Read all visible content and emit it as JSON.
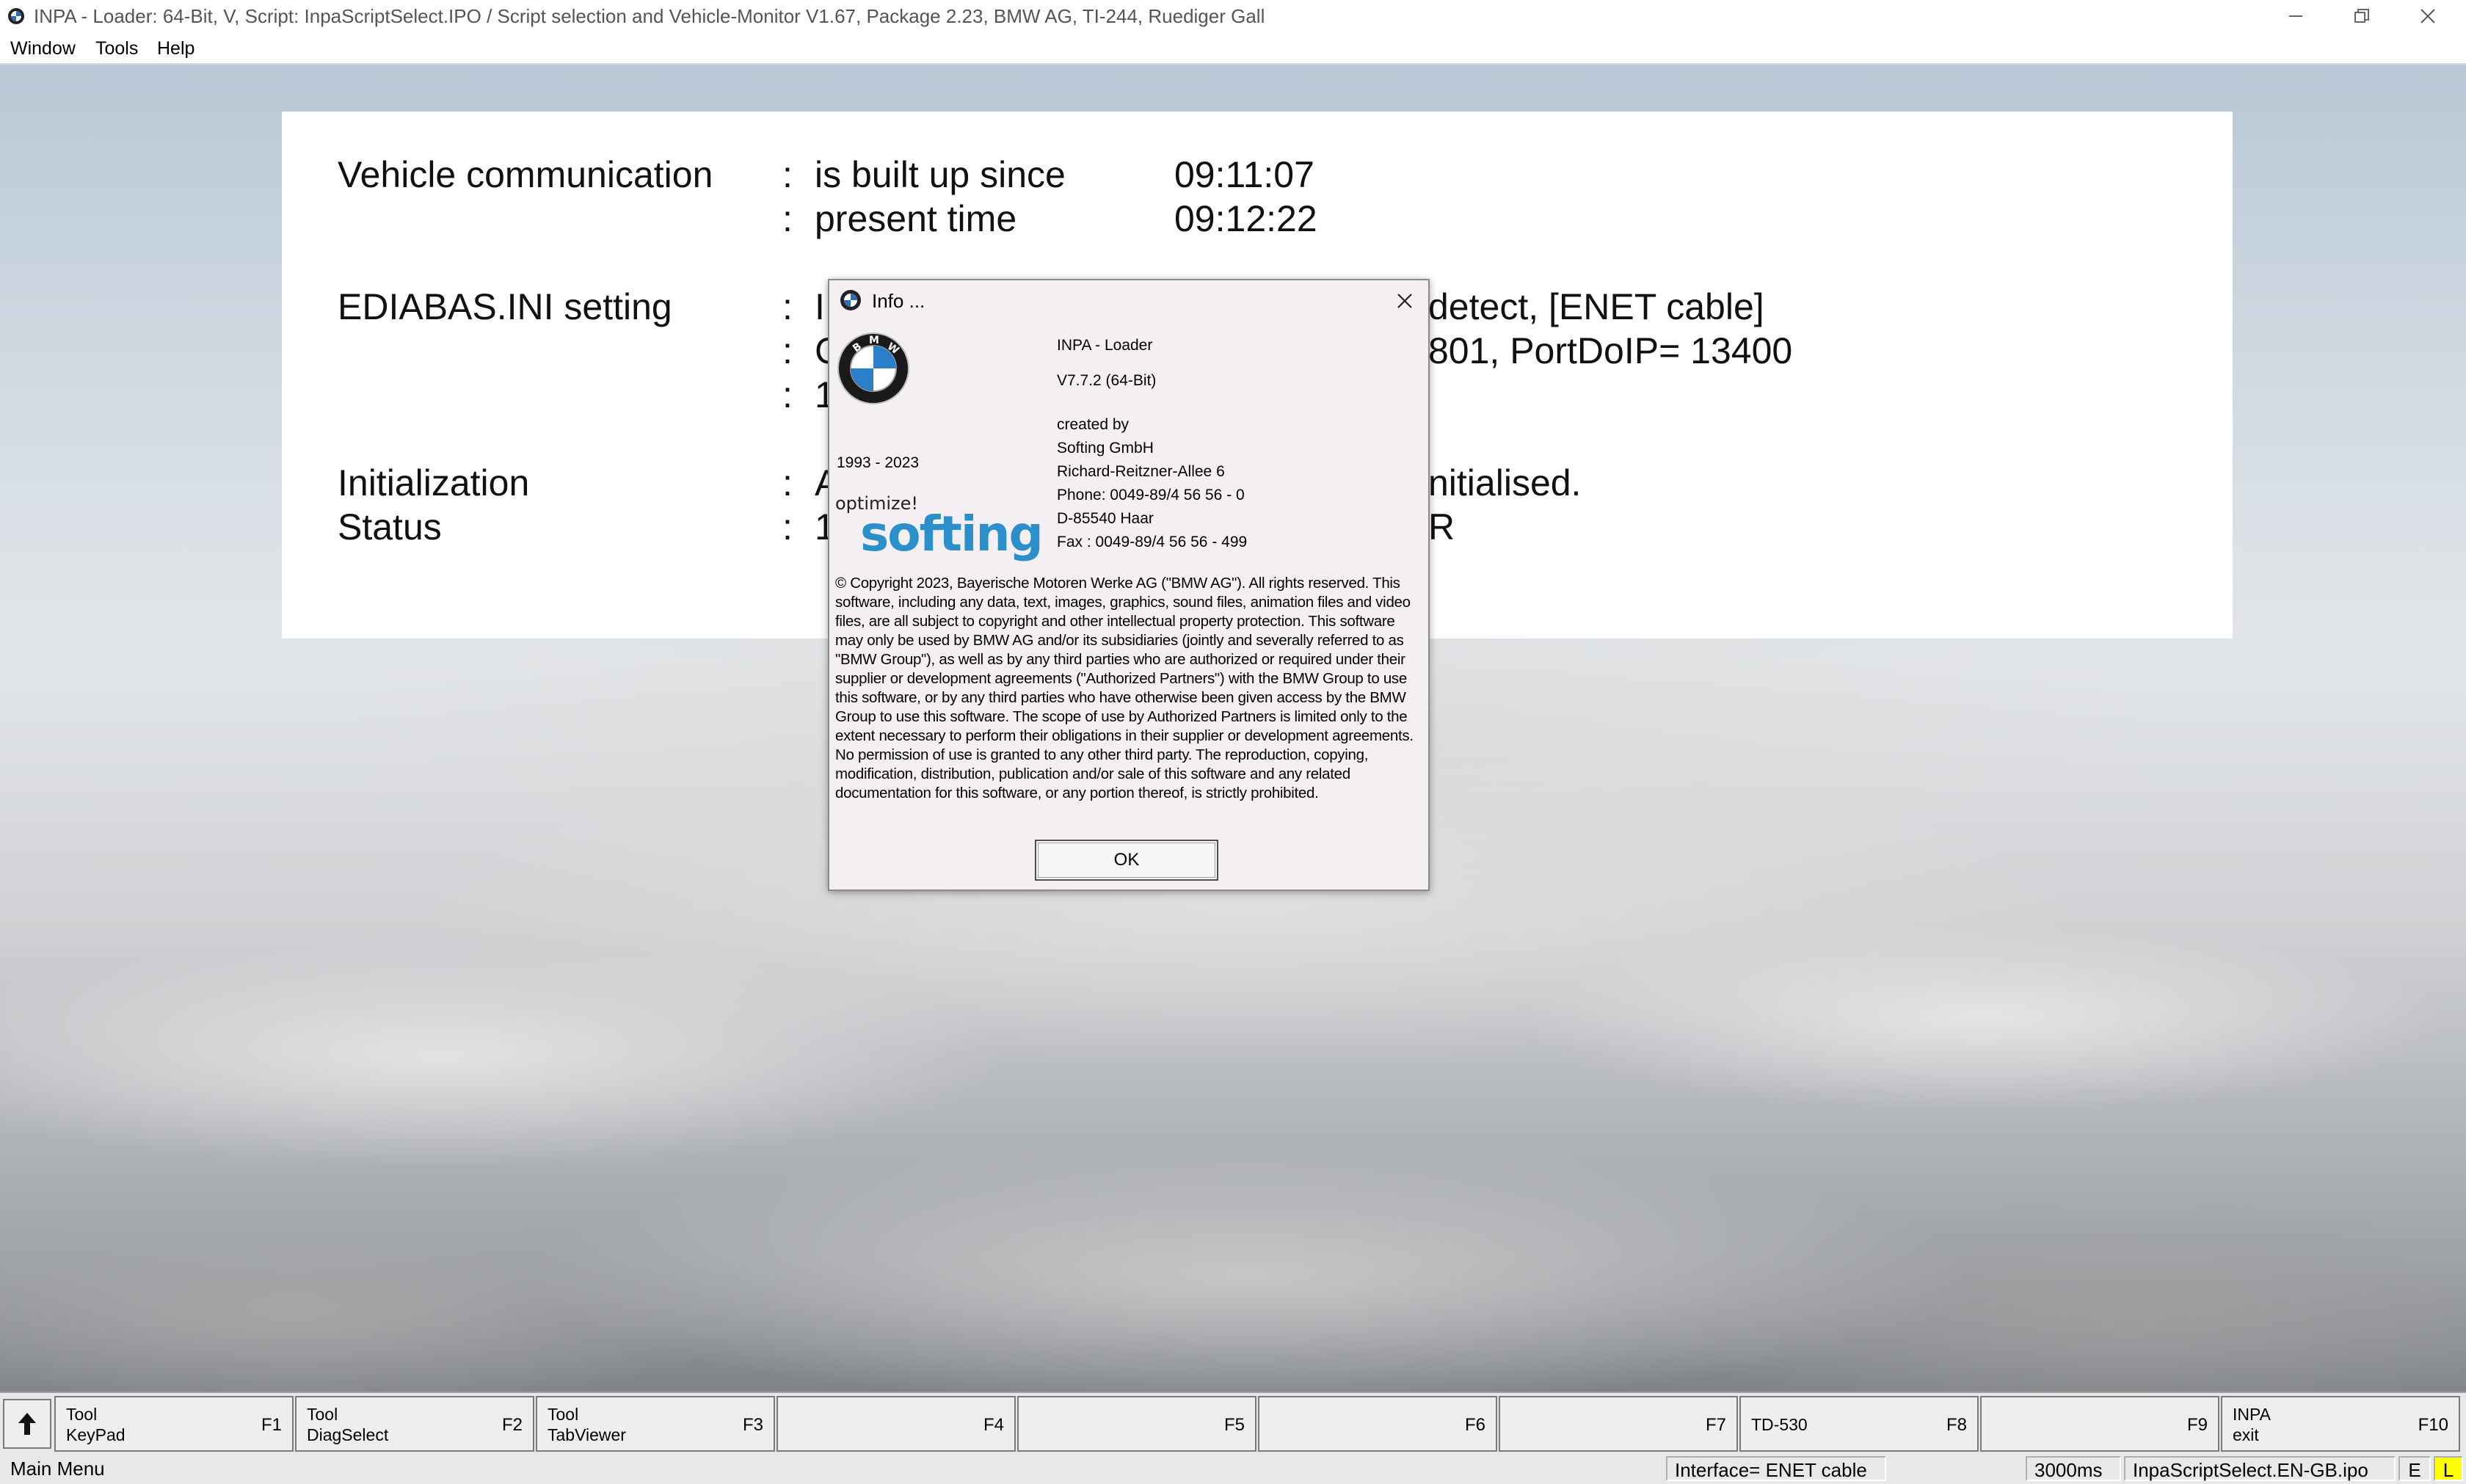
{
  "window": {
    "title": "INPA - Loader:  64-Bit, V, Script: InpaScriptSelect.IPO / Script selection and Vehicle-Monitor V1.67, Package 2.23, BMW AG, TI-244, Ruediger Gall"
  },
  "menu": {
    "items": [
      "Window",
      "Tools",
      "Help"
    ]
  },
  "info": {
    "rows": [
      {
        "label": "Vehicle communication",
        "sep": ":",
        "value": "is built up since",
        "time": "09:11:07"
      },
      {
        "label": "",
        "sep": ":",
        "value": "present time",
        "time": "09:12:22"
      },
      {
        "label": "EDIABAS.INI setting",
        "sep": ":",
        "value": "I",
        "tail": "detect, [ENET cable]"
      },
      {
        "label": "",
        "sep": ":",
        "value": "C",
        "tail": "801, PortDoIP= 13400"
      },
      {
        "label": "",
        "sep": ":",
        "value": "1",
        "tail": ""
      },
      {
        "label": "Initialization",
        "sep": ":",
        "value": "A",
        "tail": "nitialised."
      },
      {
        "label": "Status",
        "sep": ":",
        "value": "1",
        "tail": "R"
      }
    ]
  },
  "dialog": {
    "title": "Info ...",
    "product": "INPA - Loader",
    "version": "V7.7.2  (64-Bit)",
    "created_by": "created by",
    "company": "Softing GmbH",
    "street": "Richard-Reitzner-Allee 6",
    "phone": "Phone: 0049-89/4 56 56 - 0",
    "city": "D-85540 Haar",
    "fax": "Fax  : 0049-89/4 56 56 - 499",
    "years": "1993 - 2023",
    "bmw_logo_letters": "BMW",
    "softing_logo": {
      "tagline": "optimize!",
      "word": "softing"
    },
    "copyright": "© Copyright 2023, Bayerische Motoren Werke AG (\"BMW AG\"). All rights reserved. This software, including any data, text, images, graphics, sound files, animation files and video files, are all subject to copyright and other intellectual property protection. This software may only be used by BMW AG and/or its subsidiaries (jointly and severally referred to as \"BMW Group\"), as well as by any third parties who are authorized or required under their supplier or development agreements (\"Authorized Partners\") with the BMW Group to use this software, or by any third parties who have otherwise been given access by the BMW Group to use this software. The scope of use by Authorized Partners is limited only to the extent necessary to perform their obligations in their supplier or development agreements.  No permission of use is granted to any other third party. The reproduction, copying, modification, distribution, publication and/or sale of this software and any related documentation for this software, or any portion thereof, is strictly prohibited.",
    "ok_label": "OK"
  },
  "fkeys": [
    {
      "line1": "Tool",
      "line2": "KeyPad",
      "key": "F1"
    },
    {
      "line1": "Tool",
      "line2": "DiagSelect",
      "key": "F2"
    },
    {
      "line1": "Tool",
      "line2": "TabViewer",
      "key": "F3"
    },
    {
      "line1": "",
      "line2": "",
      "key": "F4"
    },
    {
      "line1": "",
      "line2": "",
      "key": "F5"
    },
    {
      "line1": "",
      "line2": "",
      "key": "F6"
    },
    {
      "line1": "",
      "line2": "",
      "key": "F7"
    },
    {
      "line1": "TD-530",
      "line2": "",
      "key": "F8"
    },
    {
      "line1": "",
      "line2": "",
      "key": "F9"
    },
    {
      "line1": "INPA",
      "line2": "exit",
      "key": "F10"
    }
  ],
  "status": {
    "menu": "Main Menu",
    "interface": "Interface= ENET cable",
    "timing": "3000ms",
    "script": "InpaScriptSelect.EN-GB.ipo",
    "flag_e": "E",
    "flag_l": "L"
  },
  "colors": {
    "status_l_bg": "#ffff00",
    "dialog_bg": "#f3eff2",
    "softing_blue": "#2b8fc9"
  },
  "icons": [
    "app-icon",
    "minimize-icon",
    "restore-icon",
    "close-icon",
    "bmw-logo-icon",
    "up-arrow-icon"
  ]
}
